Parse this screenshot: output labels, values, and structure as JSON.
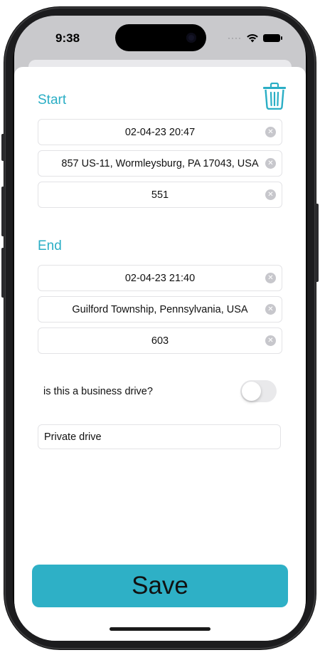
{
  "status_bar": {
    "time": "9:38"
  },
  "sheet": {
    "start_label": "Start",
    "end_label": "End",
    "start": {
      "datetime": "02-04-23 20:47",
      "address": "857 US-11, Wormleysburg, PA 17043, USA",
      "odometer": "551"
    },
    "end": {
      "datetime": "02-04-23 21:40",
      "address": "Guilford Township, Pennsylvania, USA",
      "odometer": "603"
    },
    "business_question": "is this a business drive?",
    "business_toggle_on": false,
    "drive_type": "Private drive",
    "save_label": "Save"
  },
  "colors": {
    "accent": "#2aaec5",
    "save_button": "#2eb0c6",
    "toggle_off": "#e9e9eb"
  },
  "icons": {
    "delete": "trash-icon",
    "clear": "clear-circle-icon"
  }
}
